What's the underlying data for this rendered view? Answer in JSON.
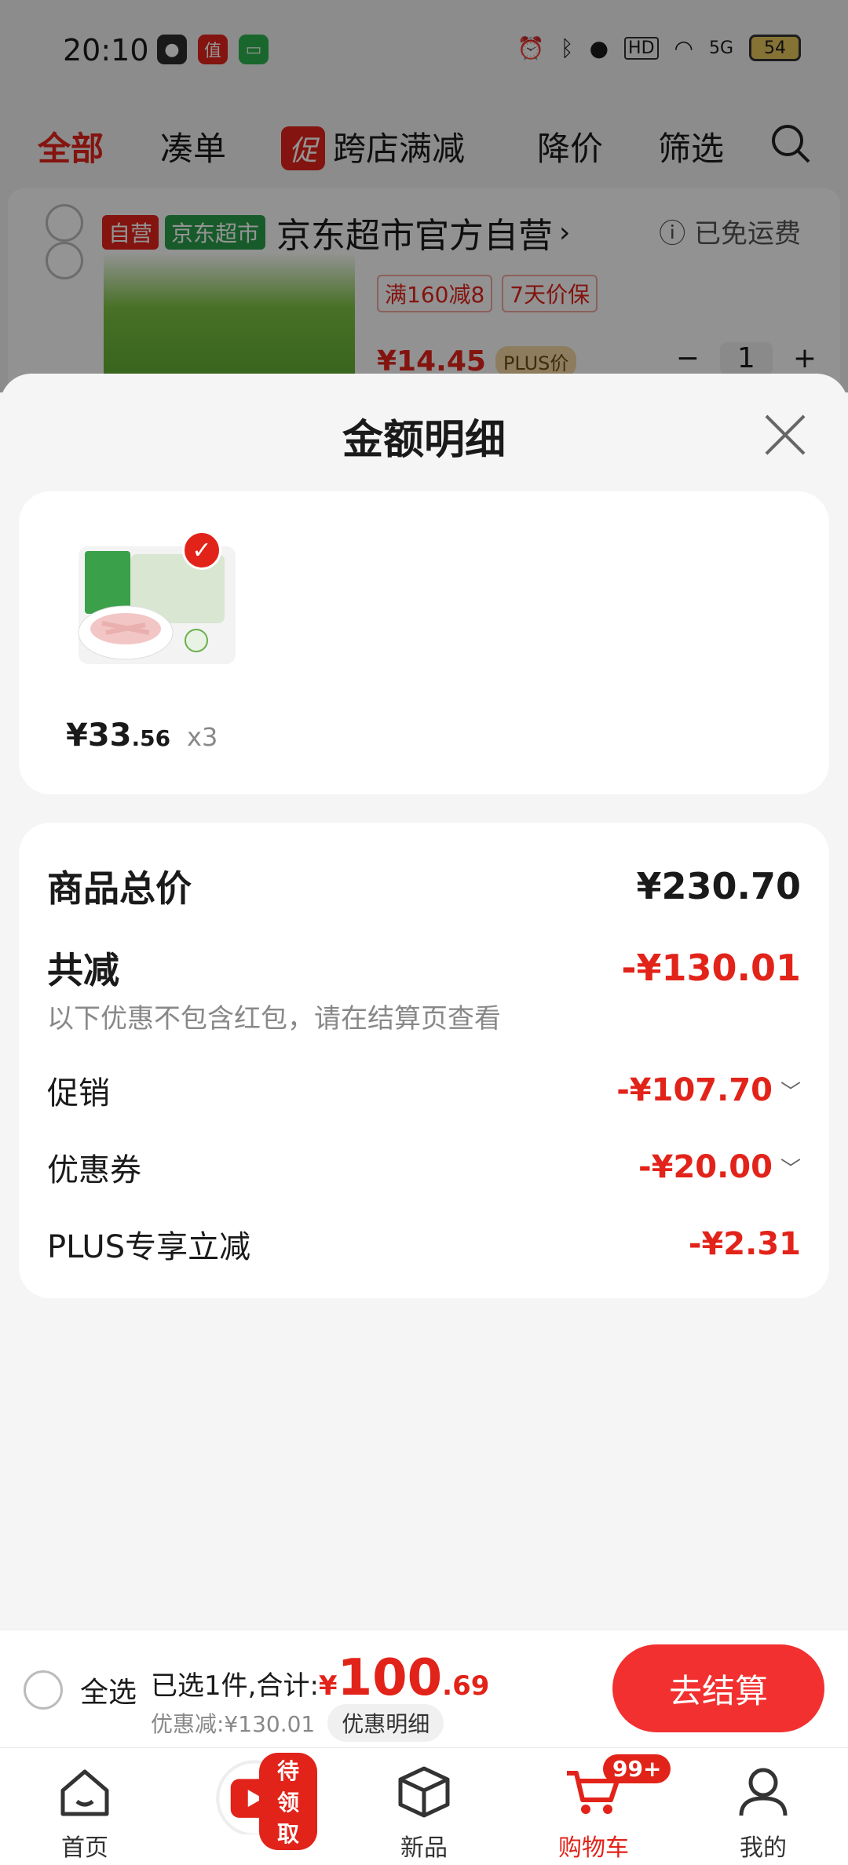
{
  "status_bar": {
    "time": "20:10",
    "battery": "54",
    "network": "5G"
  },
  "top_nav": {
    "items": [
      "全部",
      "凑单",
      "跨店满减",
      "降价",
      "筛选"
    ],
    "promo_tag": "促"
  },
  "store": {
    "tag_self": "自营",
    "tag_market": "京东超市",
    "name": "京东超市官方自营",
    "chevron": "›",
    "shipping": "已免运费",
    "promo1": "满160减8",
    "promo2": "7天价保",
    "price": "¥14.45",
    "plus_tag": "PLUS价",
    "qty": "1"
  },
  "sheet": {
    "title": "金额明细",
    "item": {
      "price_int": "¥33",
      "price_dec": ".56",
      "qty": "x3"
    },
    "details": {
      "total_label": "商品总价",
      "total_value": "¥230.70",
      "discount_label": "共减",
      "discount_value": "-¥130.01",
      "note": "以下优惠不包含红包，请在结算页查看",
      "promo_label": "促销",
      "promo_value": "-¥107.70",
      "coupon_label": "优惠券",
      "coupon_value": "-¥20.00",
      "plus_label": "PLUS专享立减",
      "plus_value": "-¥2.31"
    }
  },
  "checkout": {
    "select_all": "全选",
    "summary_prefix": "已选1件,合计:",
    "currency": "¥",
    "total_int": "100",
    "total_dec": ".69",
    "discount": "优惠减:¥130.01",
    "discount_detail": "优惠明细",
    "pay": "去结算"
  },
  "tabs": {
    "home": "首页",
    "video_badge": "待领取",
    "new": "新品",
    "cart": "购物车",
    "cart_badge": "99+",
    "mine": "我的"
  },
  "colors": {
    "accent": "#e2231a",
    "pay_button": "#f23030"
  }
}
